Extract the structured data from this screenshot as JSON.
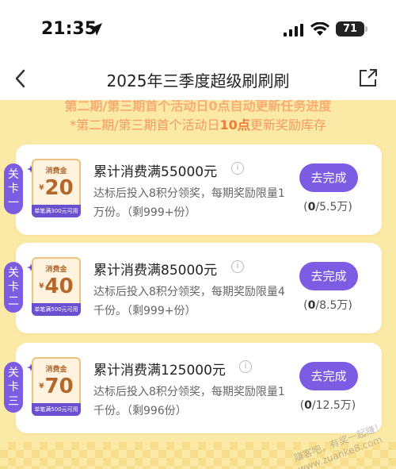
{
  "status_bar": {
    "time": "21:35",
    "battery": "71"
  },
  "nav": {
    "title": "2025年三季度超级刷刷刷"
  },
  "notices": {
    "line1": "第二期/第三期首个活动日0点自动更新任务进度",
    "line2_prefix": "*第二期/第三期首个活动日",
    "line2_bold": "10点",
    "line2_suffix": "更新奖励库存"
  },
  "tasks": [
    {
      "level_char1": "关",
      "level_char2": "卡",
      "level_char3": "一",
      "coupon_top": "消费金",
      "coupon_yen": "¥",
      "coupon_amount": "20",
      "coupon_bottom": "单笔满300元可用",
      "title": "累计消费满55000元",
      "info": "i",
      "desc": "达标后投入8积分领奖，每期奖励限量1万份。（剩999+份）",
      "button": "去完成",
      "progress_open": "(",
      "progress_done": "0",
      "progress_total": "/5.5万)"
    },
    {
      "level_char1": "关",
      "level_char2": "卡",
      "level_char3": "二",
      "coupon_top": "消费金",
      "coupon_yen": "¥",
      "coupon_amount": "40",
      "coupon_bottom": "单笔满500元可用",
      "title": "累计消费满85000元",
      "info": "i",
      "desc": "达标后投入8积分领奖，每期奖励限量4千份。（剩999+份）",
      "button": "去完成",
      "progress_open": "(",
      "progress_done": "0",
      "progress_total": "/8.5万)"
    },
    {
      "level_char1": "关",
      "level_char2": "卡",
      "level_char3": "三",
      "coupon_top": "消费金",
      "coupon_yen": "¥",
      "coupon_amount": "70",
      "coupon_bottom": "单笔满500元可用",
      "title": "累计消费满125000元",
      "info": "i",
      "desc": "达标后投入8积分领奖，每期奖励限量1千份。（剩996份）",
      "button": "去完成",
      "progress_open": "(",
      "progress_done": "0",
      "progress_total": "/12.5万)"
    }
  ],
  "watermark": "赚客吧，有奖一起赚！ www.zuanke8.com",
  "colors": {
    "accent": "#7c5ce2",
    "background": "#fbe9a6",
    "notice": "#f59a62"
  }
}
